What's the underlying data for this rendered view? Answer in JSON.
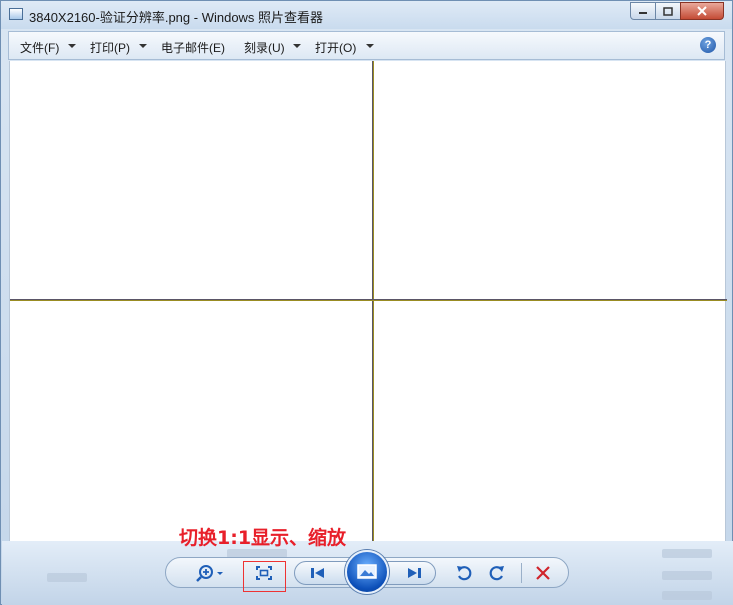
{
  "window": {
    "title": "3840X2160-验证分辨率.png - Windows 照片查看器",
    "minimize_icon": "minimize-icon",
    "maximize_icon": "maximize-icon",
    "close_icon": "close-icon"
  },
  "menu": {
    "items": [
      {
        "label": "文件(F)",
        "has_dropdown": true
      },
      {
        "label": "打印(P)",
        "has_dropdown": true
      },
      {
        "label": "电子邮件(E)",
        "has_dropdown": false
      },
      {
        "label": "刻录(U)",
        "has_dropdown": true
      },
      {
        "label": "打开(O)",
        "has_dropdown": true
      }
    ],
    "help_icon": "help-icon",
    "help_glyph": "?"
  },
  "annotation": {
    "text": "切换1:1显示、缩放",
    "color": "#e8202a"
  },
  "controls": {
    "zoom": "zoom-icon",
    "actual_size": "actual-size-icon",
    "previous": "previous-icon",
    "slideshow": "slideshow-icon",
    "next": "next-icon",
    "rotate_ccw": "rotate-counterclockwise-icon",
    "rotate_cw": "rotate-clockwise-icon",
    "delete": "delete-icon"
  },
  "colors": {
    "accent": "#1f5fb8",
    "delete": "#d0242b",
    "annotation_box": "#e33333"
  }
}
